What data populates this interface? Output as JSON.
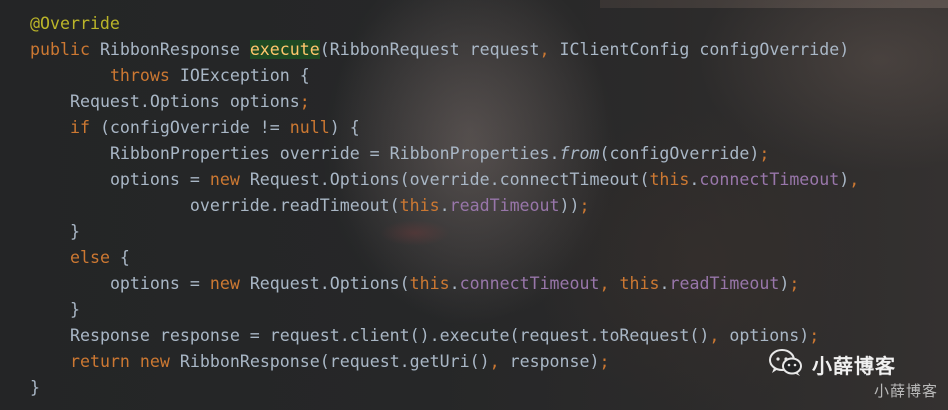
{
  "colors": {
    "keyword": "#cc7832",
    "annotation": "#bbb529",
    "field": "#9876aa",
    "method_highlight_bg": "#1e4a23",
    "method_highlight_fg": "#ffc66d",
    "default_text": "#a9b7c6"
  },
  "code": {
    "line1": {
      "annotation": "@Override"
    },
    "line2": {
      "kw_public": "public",
      "t_ret": " RibbonResponse ",
      "method": "execute",
      "t_params1": "(RibbonRequest request",
      "comma": ",",
      "t_params2": " IClientConfig configOverride)"
    },
    "line3": {
      "indent": "        ",
      "kw_throws": "throws",
      "t_exc": " IOException {"
    },
    "line4": {
      "indent": "    ",
      "t_decl": "Request.Options options",
      "semi": ";"
    },
    "line5": {
      "indent": "    ",
      "kw_if": "if",
      "t_cond": " (configOverride != ",
      "kw_null": "null",
      "t_end": ") {"
    },
    "line6": {
      "indent": "        ",
      "t_decl": "RibbonProperties override = RibbonProperties.",
      "m_from": "from",
      "t_args": "(configOverride)",
      "semi": ";"
    },
    "line7": {
      "indent": "        ",
      "t_assign": "options = ",
      "kw_new": "new",
      "t_ctor": " Request.Options(override.connectTimeout(",
      "kw_this": "this",
      "dot": ".",
      "f_conn": "connectTimeout",
      "t_end": ")",
      "comma": ","
    },
    "line8": {
      "indent": "                ",
      "t_call": "override.readTimeout(",
      "kw_this": "this",
      "dot": ".",
      "f_read": "readTimeout",
      "t_end": "))",
      "semi": ";"
    },
    "line9": {
      "indent": "    ",
      "t_brace": "}"
    },
    "line10": {
      "indent": "    ",
      "kw_else": "else",
      "t_brace": " {"
    },
    "line11": {
      "indent": "        ",
      "t_assign": "options = ",
      "kw_new": "new",
      "t_ctor": " Request.Options(",
      "kw_this1": "this",
      "dot1": ".",
      "f_conn": "connectTimeout",
      "comma": ",",
      "space": " ",
      "kw_this2": "this",
      "dot2": ".",
      "f_read": "readTimeout",
      "t_end": ")",
      "semi": ";"
    },
    "line12": {
      "indent": "    ",
      "t_brace": "}"
    },
    "line13": {
      "indent": "    ",
      "t_stmt": "Response response = request.client().execute(request.toRequest()",
      "comma": ",",
      "t_end": " options)",
      "semi": ";"
    },
    "line14": {
      "indent": "    ",
      "kw_return": "return",
      "space": " ",
      "kw_new": "new",
      "t_ctor": " RibbonResponse(request.getUri()",
      "comma": ",",
      "t_end": " response)",
      "semi": ";"
    },
    "line15": {
      "t_brace": "}"
    }
  },
  "watermark": {
    "icon": "wechat-icon",
    "title": "小薛博客",
    "subtitle": "小薛博客"
  }
}
